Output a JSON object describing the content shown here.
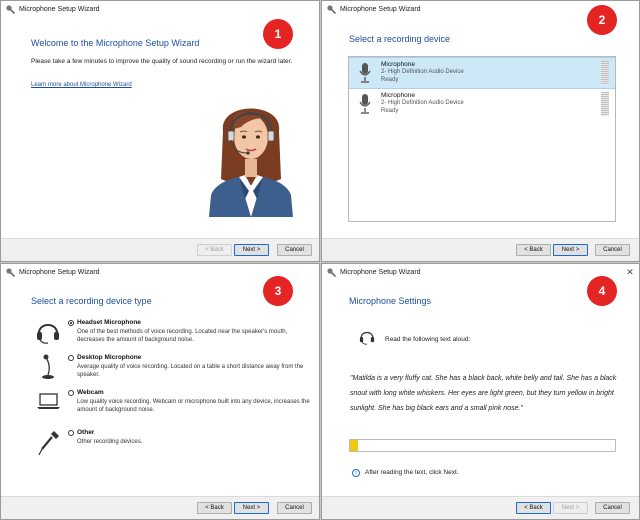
{
  "window_title": "Microphone Setup Wizard",
  "buttons": {
    "back": "< Back",
    "next": "Next >",
    "cancel": "Cancel"
  },
  "badge_color": "#e52424",
  "panel1": {
    "badge": "1",
    "heading": "Welcome to the Microphone Setup Wizard",
    "intro": "Please take a few minutes to improve the quality of sound recording or run the wizard later.",
    "link": "Learn more about Microphone Wizard",
    "illustration": "headset-operator-woman"
  },
  "panel2": {
    "badge": "2",
    "heading": "Select a recording device",
    "devices": [
      {
        "name": "Microphone",
        "description": "2- High Definition Audio Device",
        "status": "Ready",
        "selected": true
      },
      {
        "name": "Microphone",
        "description": "2- High Definition Audio Device",
        "status": "Ready",
        "selected": false
      }
    ]
  },
  "panel3": {
    "badge": "3",
    "heading": "Select a recording device type",
    "options": [
      {
        "label": "Headset Microphone",
        "description": "One of the best methods of voice recording. Located near the speaker's mouth, decreases the amount of background noise.",
        "selected": true,
        "icon": "headset-icon"
      },
      {
        "label": "Desktop Microphone",
        "description": "Average quality of voice recording. Located on a table a short distance away from the speaker.",
        "selected": false,
        "icon": "desktop-mic-icon"
      },
      {
        "label": "Webcam",
        "description": "Low quality voice recording. Webcam or microphone built into any device, increases the amount of background noise.",
        "selected": false,
        "icon": "webcam-laptop-icon"
      },
      {
        "label": "Other",
        "description": "Other recording devices.",
        "selected": false,
        "icon": "other-mic-icon"
      }
    ]
  },
  "panel4": {
    "badge": "4",
    "heading": "Microphone Settings",
    "instruction": "Read the following text aloud:",
    "passage": "\"Matilda is a very fluffy cat. She has a black back, white belly and tail. She has a black snout with long white whiskers. Her eyes are light green, but they turn yellow in bright sunlight. She has big black ears and a small pink nose.\"",
    "progress": 0.03,
    "progress_color": "#f2c811",
    "hint": "After reading the text, click Next."
  }
}
